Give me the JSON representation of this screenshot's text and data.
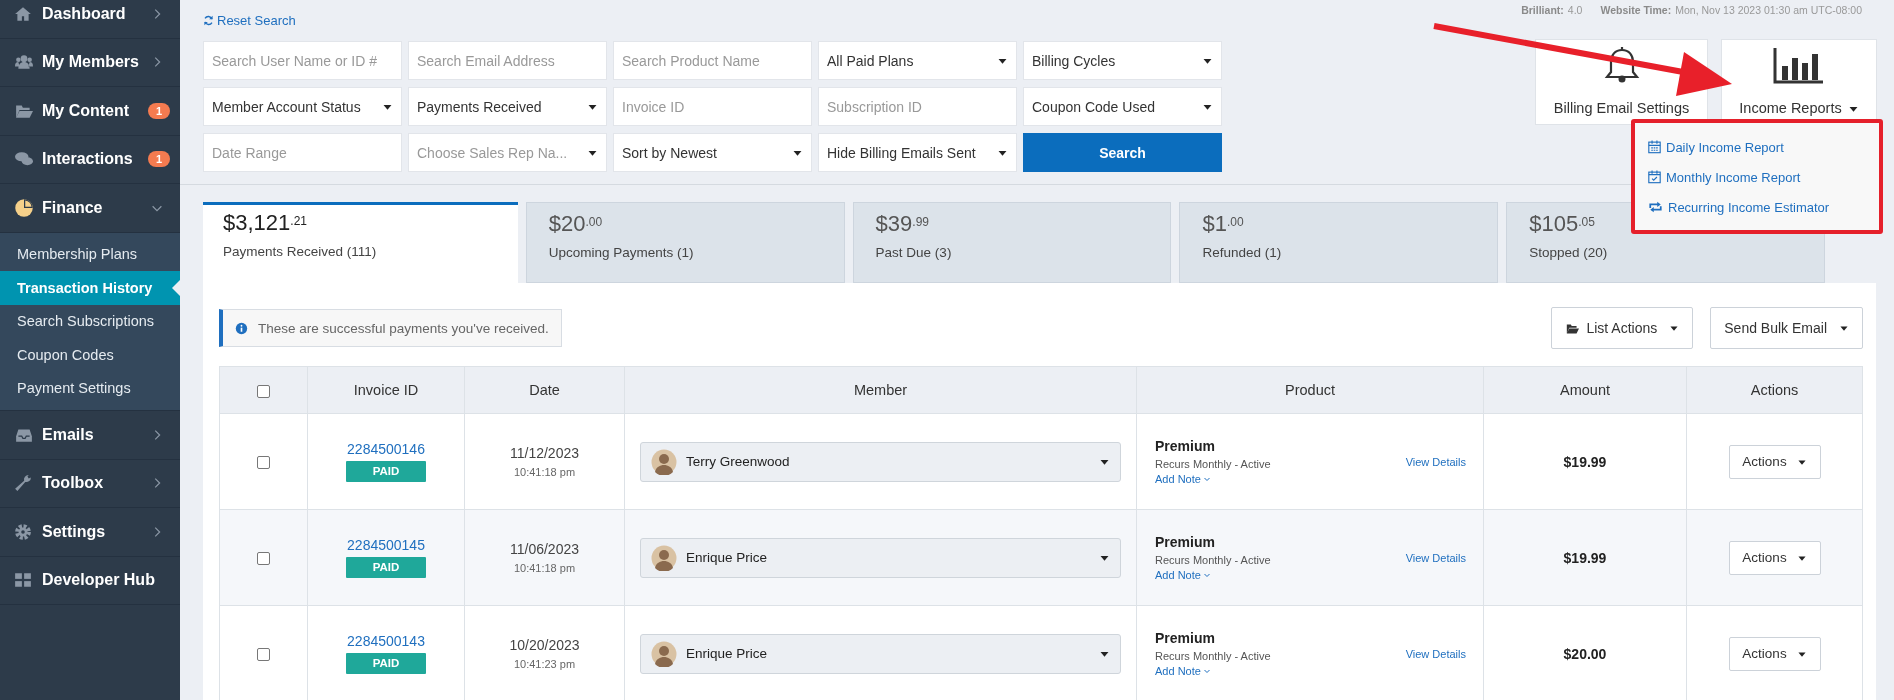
{
  "sidebar": {
    "items": [
      {
        "label": "Dashboard",
        "kind": "menu",
        "expanded": false
      },
      {
        "label": "My Members",
        "kind": "menu",
        "expanded": false
      },
      {
        "label": "My Content",
        "kind": "badge",
        "badge": "1"
      },
      {
        "label": "Interactions",
        "kind": "badge",
        "badge": "1"
      },
      {
        "label": "Finance",
        "kind": "menu",
        "expanded": true,
        "children": [
          {
            "label": "Membership Plans",
            "selected": false
          },
          {
            "label": "Transaction History",
            "selected": true
          },
          {
            "label": "Search Subscriptions",
            "selected": false
          },
          {
            "label": "Coupon Codes",
            "selected": false
          },
          {
            "label": "Payment Settings",
            "selected": false
          }
        ]
      },
      {
        "label": "Emails",
        "kind": "menu",
        "expanded": false
      },
      {
        "label": "Toolbox",
        "kind": "menu",
        "expanded": false
      },
      {
        "label": "Settings",
        "kind": "menu",
        "expanded": false
      },
      {
        "label": "Developer Hub",
        "kind": "link"
      }
    ]
  },
  "reset_search": "Reset Search",
  "meta": {
    "version_label": "Brilliant:",
    "version": "4.0",
    "time_label": "Website Time:",
    "time": "Mon, Nov 13 2023 01:30 am UTC-08:00"
  },
  "filters": [
    {
      "kind": "input",
      "placeholder": "Search User Name or ID #"
    },
    {
      "kind": "input",
      "placeholder": "Search Email Address"
    },
    {
      "kind": "input",
      "placeholder": "Search Product Name"
    },
    {
      "kind": "select",
      "value": "All Paid Plans"
    },
    {
      "kind": "select",
      "value": "Billing Cycles"
    },
    {
      "kind": "select",
      "value": "Member Account Status"
    },
    {
      "kind": "select",
      "value": "Payments Received"
    },
    {
      "kind": "input",
      "placeholder": "Invoice ID"
    },
    {
      "kind": "input",
      "placeholder": "Subscription ID"
    },
    {
      "kind": "select",
      "value": "Coupon Code Used"
    },
    {
      "kind": "input",
      "placeholder": "Date Range"
    },
    {
      "kind": "select",
      "placeholder": "Choose Sales Rep Na..."
    },
    {
      "kind": "select",
      "value": "Sort by Newest"
    },
    {
      "kind": "select",
      "value": "Hide Billing Emails Sent"
    },
    {
      "kind": "button",
      "label": "Search"
    }
  ],
  "tools": [
    {
      "label": "Billing Email Settings",
      "has_menu": false
    },
    {
      "label": "Income Reports",
      "has_menu": true
    }
  ],
  "income_menu": {
    "expanded": true,
    "items": [
      "Daily Income Report",
      "Monthly Income Report",
      "Recurring Income Estimator"
    ]
  },
  "tabs": [
    {
      "amount": "$3,121",
      "cents": ".21",
      "label": "Payments Received (111)",
      "selected": true
    },
    {
      "amount": "$20",
      "cents": ".00",
      "label": "Upcoming Payments (1)",
      "selected": false
    },
    {
      "amount": "$39",
      "cents": ".99",
      "label": "Past Due (3)",
      "selected": false
    },
    {
      "amount": "$1",
      "cents": ".00",
      "label": "Refunded (1)",
      "selected": false
    },
    {
      "amount": "$105",
      "cents": ".05",
      "label": "Stopped (20)",
      "selected": false
    }
  ],
  "info": "These are successful payments you've received.",
  "list_buttons": [
    "List Actions",
    "Send Bulk Email"
  ],
  "table": {
    "select_all": false,
    "columns": [
      "Invoice ID",
      "Date",
      "Member",
      "Product",
      "Amount",
      "Actions"
    ],
    "rows": [
      {
        "checked": false,
        "invoice_id": "2284500146",
        "status": "PAID",
        "date": "11/12/2023",
        "time": "10:41:18 pm",
        "member": "Terry Greenwood",
        "product": "Premium",
        "plan": "Recurs Monthly - Active",
        "add_note": "Add Note",
        "view_details": "View Details",
        "amount": "$19.99",
        "actions": "Actions"
      },
      {
        "checked": false,
        "invoice_id": "2284500145",
        "status": "PAID",
        "date": "11/06/2023",
        "time": "10:41:18 pm",
        "member": "Enrique Price",
        "product": "Premium",
        "plan": "Recurs Monthly - Active",
        "add_note": "Add Note",
        "view_details": "View Details",
        "amount": "$19.99",
        "actions": "Actions"
      },
      {
        "checked": false,
        "invoice_id": "2284500143",
        "status": "PAID",
        "date": "10/20/2023",
        "time": "10:41:23 pm",
        "member": "Enrique Price",
        "product": "Premium",
        "plan": "Recurs Monthly - Active",
        "add_note": "Add Note",
        "view_details": "View Details",
        "amount": "$20.00",
        "actions": "Actions"
      }
    ]
  }
}
